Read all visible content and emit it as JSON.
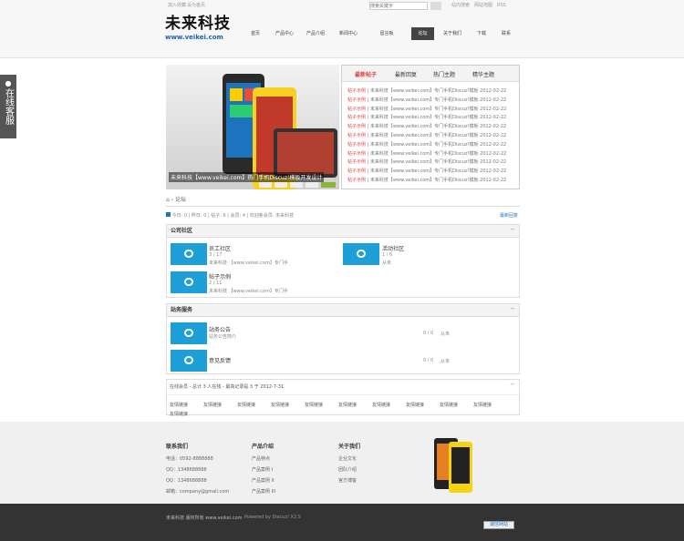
{
  "top": {
    "links": [
      "加入收藏",
      "设为首页"
    ],
    "search_placeholder": "搜索关键字",
    "right_links": [
      "站内搜索",
      "网站地图",
      "RSS"
    ]
  },
  "logo": {
    "title": "未来科技",
    "url": "www.veikei.com"
  },
  "nav": [
    "首页",
    "产品中心",
    "产品介绍",
    "新闻中心",
    "留言板",
    "论坛",
    "关于我们",
    "下载",
    "联系"
  ],
  "nav_active_index": 5,
  "leftbar": {
    "label": "在线客服"
  },
  "slide": {
    "caption": "未来科技【www.veikei.com】热门手机Discuz!模板开发设计"
  },
  "news": {
    "tabs": [
      "最新帖子",
      "最新回复",
      "热门主题",
      "精华主题"
    ],
    "rows": [
      {
        "tag": "帖子示例",
        "text": "未来科技【www.veikei.com】专门手机Discuz!模板",
        "date": "2012-02-22"
      },
      {
        "tag": "帖子示例",
        "text": "未来科技【www.veikei.com】专门手机Discuz!模板",
        "date": "2012-02-22"
      },
      {
        "tag": "帖子示例",
        "text": "未来科技【www.veikei.com】专门手机Discuz!模板",
        "date": "2012-02-22"
      },
      {
        "tag": "帖子示例",
        "text": "未来科技【www.veikei.com】专门手机Discuz!模板",
        "date": "2012-02-22"
      },
      {
        "tag": "帖子示例",
        "text": "未来科技【www.veikei.com】专门手机Discuz!模板",
        "date": "2012-02-22"
      },
      {
        "tag": "帖子示例",
        "text": "未来科技【www.veikei.com】专门手机Discuz!模板",
        "date": "2012-02-22"
      },
      {
        "tag": "帖子示例",
        "text": "未来科技【www.veikei.com】专门手机Discuz!模板",
        "date": "2012-02-22"
      },
      {
        "tag": "帖子示例",
        "text": "未来科技【www.veikei.com】专门手机Discuz!模板",
        "date": "2012-02-22"
      },
      {
        "tag": "帖子示例",
        "text": "未来科技【www.veikei.com】专门手机Discuz!模板",
        "date": "2012-02-22"
      },
      {
        "tag": "帖子示例",
        "text": "未来科技【www.veikei.com】专门手机Discuz!模板",
        "date": "2012-02-22"
      },
      {
        "tag": "帖子示例",
        "text": "未来科技【www.veikei.com】专门手机Discuz!模板",
        "date": "2012-02-22"
      }
    ]
  },
  "breadcrumb": "论坛",
  "stats": {
    "text": "今日: 0 | 昨日: 0 | 帖子: 6 | 会员: 4 | 欢迎新会员: 未来科技",
    "link": "最新回复"
  },
  "sec1": {
    "title": "公司社区",
    "forums": [
      {
        "name": "员工社区",
        "count": "3 / 17",
        "desc": "未来科技 【www.veikei.com】专门手"
      },
      {
        "name": "活动社区",
        "count": "1 / 6",
        "desc": "从未"
      },
      {
        "name": "帖子示例",
        "count": "2 / 11",
        "desc": "未来科技 【www.veikei.com】专门手"
      }
    ]
  },
  "sec2": {
    "title": "站务服务",
    "forums": [
      {
        "name": "站务公告",
        "desc": "站务公告简介",
        "count": "0 / 0",
        "last": "从未"
      },
      {
        "name": "意见反馈",
        "desc": "",
        "count": "0 / 0",
        "last": "从未"
      }
    ]
  },
  "online": {
    "text": "在线会员 - 总计 3 人在线 - 最高记录是 3 于 2012-7-31.",
    "links": [
      "友情链接",
      "友情链接",
      "友情链接",
      "友情链接",
      "友情链接",
      "友情链接",
      "友情链接",
      "友情链接",
      "友情链接",
      "友情链接",
      "友情链接"
    ]
  },
  "footer": {
    "c1": {
      "title": "联系我们",
      "items": [
        "电话：0592-8888888",
        "QQ：1348688888",
        "QQ：1348688888",
        "邮箱：company@gmail.com"
      ]
    },
    "c2": {
      "title": "产品介绍",
      "items": [
        "产品特点",
        "产品案例 I",
        "产品案例 II",
        "产品案例 III"
      ]
    },
    "c3": {
      "title": "关于我们",
      "items": [
        "企业文化",
        "团队介绍",
        "官方博客"
      ]
    }
  },
  "bottom": {
    "copy": "未来科技 版权所有 www.veikei.com",
    "powered": "Powered by Discuz! X2.5",
    "badge": "诚信网站"
  }
}
